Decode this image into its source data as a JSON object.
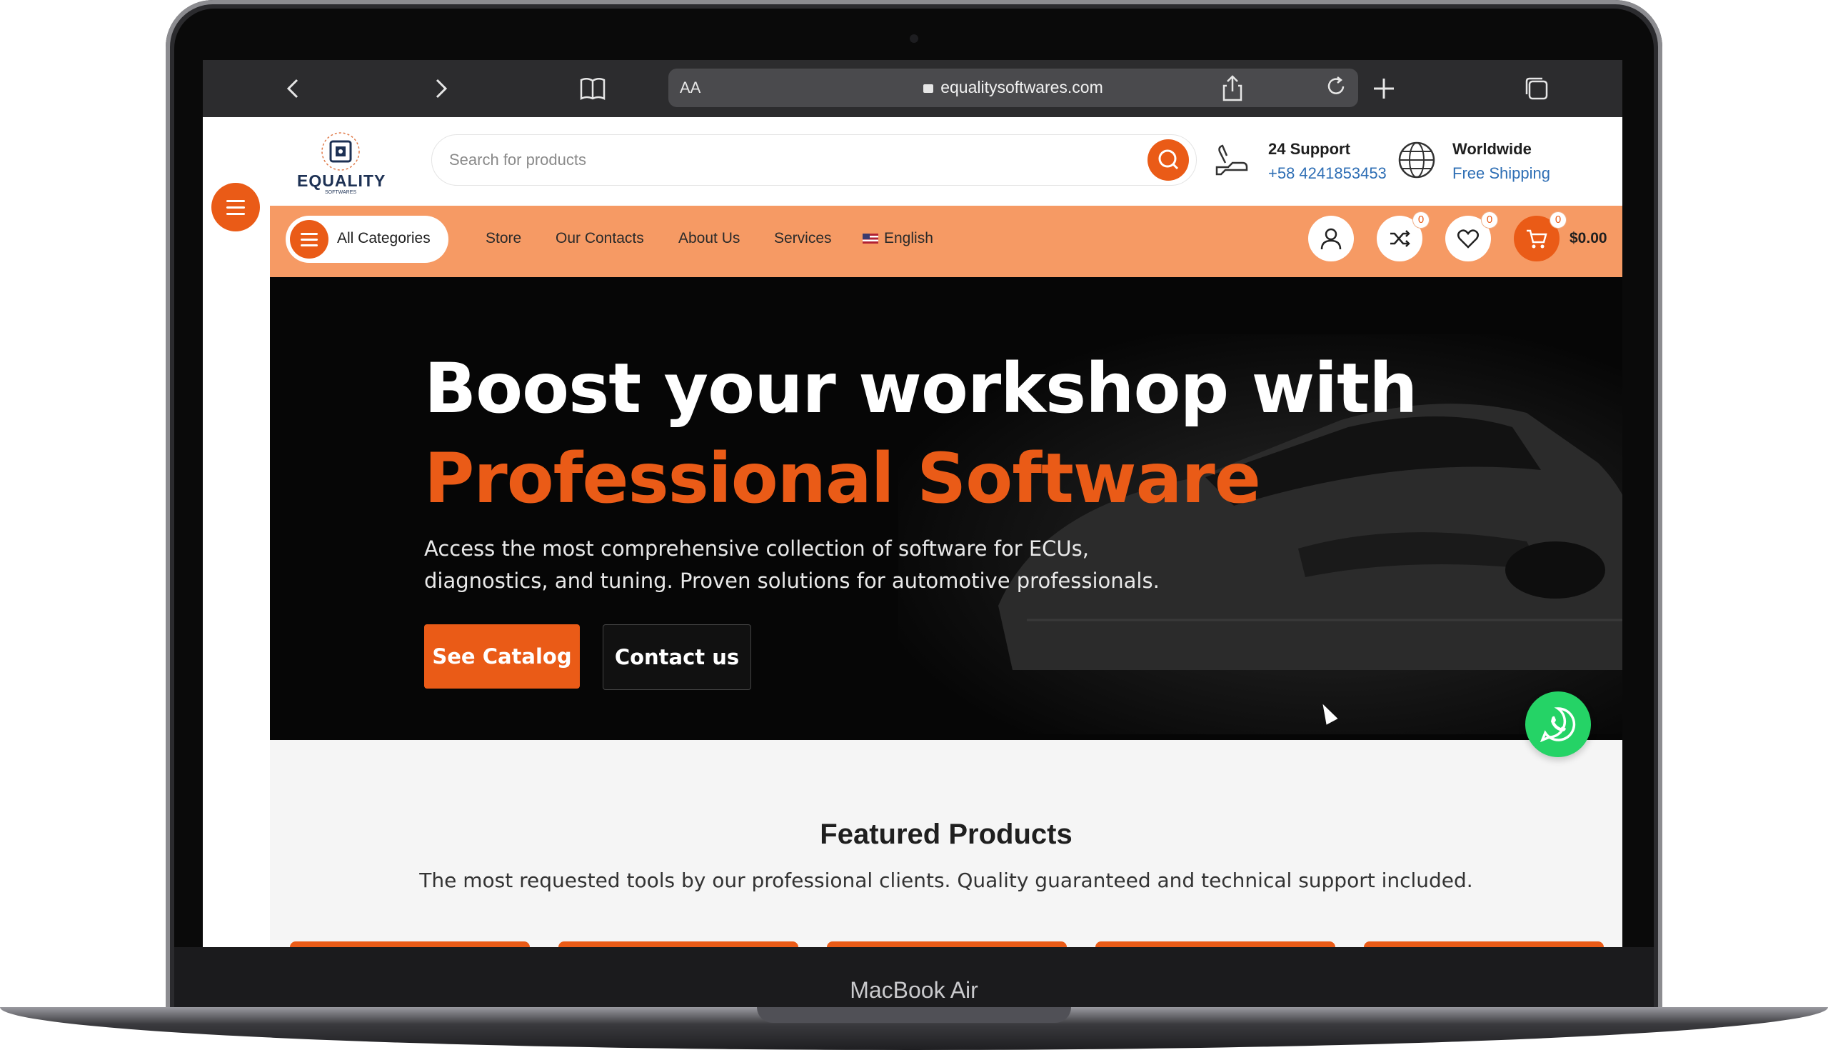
{
  "device": {
    "label": "MacBook Air"
  },
  "browser": {
    "url_aa": "AA",
    "url": "equalitysoftwares.com"
  },
  "header": {
    "logo_text": "EQUALITY",
    "logo_subtext": "SOFTWARES",
    "search_placeholder": "Search for products",
    "support_title": "24 Support",
    "support_phone": "+58 4241853453",
    "shipping_title": "Worldwide",
    "shipping_sub": "Free Shipping"
  },
  "nav": {
    "all_categories": "All Categories",
    "links": [
      "Store",
      "Our Contacts",
      "About Us",
      "Services"
    ],
    "language": "English",
    "compare_count": "0",
    "wishlist_count": "0",
    "cart_count": "0",
    "cart_total": "$0.00"
  },
  "hero": {
    "title_line1": "Boost your workshop with",
    "title_line2": "Professional Software",
    "description": "Access the most comprehensive collection of software for ECUs, diagnostics, and tuning. Proven solutions for automotive professionals.",
    "primary_button": "See Catalog",
    "secondary_button": "Contact us"
  },
  "featured": {
    "title": "Featured Products",
    "subtitle": "The most requested tools by our professional clients. Quality guaranteed and technical support included."
  },
  "colors": {
    "accent": "#ea5b17",
    "nav_bg": "#f69a64",
    "hero_bg": "#060606",
    "whatsapp": "#25d366"
  }
}
